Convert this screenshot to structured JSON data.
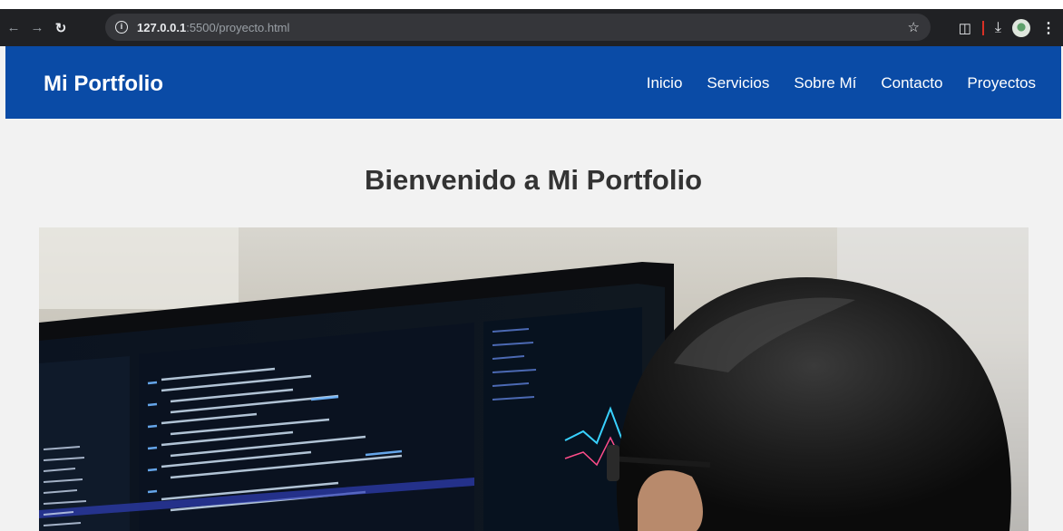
{
  "browser": {
    "url_host": "127.0.0.1",
    "url_path": ":5500/proyecto.html",
    "icons": [
      "back-arrow-icon",
      "forward-arrow-icon",
      "reload-icon",
      "info-icon",
      "star-icon",
      "extensions-icon",
      "download-icon",
      "profile-avatar",
      "menu-icon"
    ]
  },
  "header": {
    "brand": "Mi Portfolio",
    "nav": [
      {
        "label": "Inicio"
      },
      {
        "label": "Servicios"
      },
      {
        "label": "Sobre Mí"
      },
      {
        "label": "Contacto"
      },
      {
        "label": "Proyectos"
      }
    ],
    "color": "#0a4ba6"
  },
  "main": {
    "title": "Bienvenido a Mi Portfolio"
  }
}
